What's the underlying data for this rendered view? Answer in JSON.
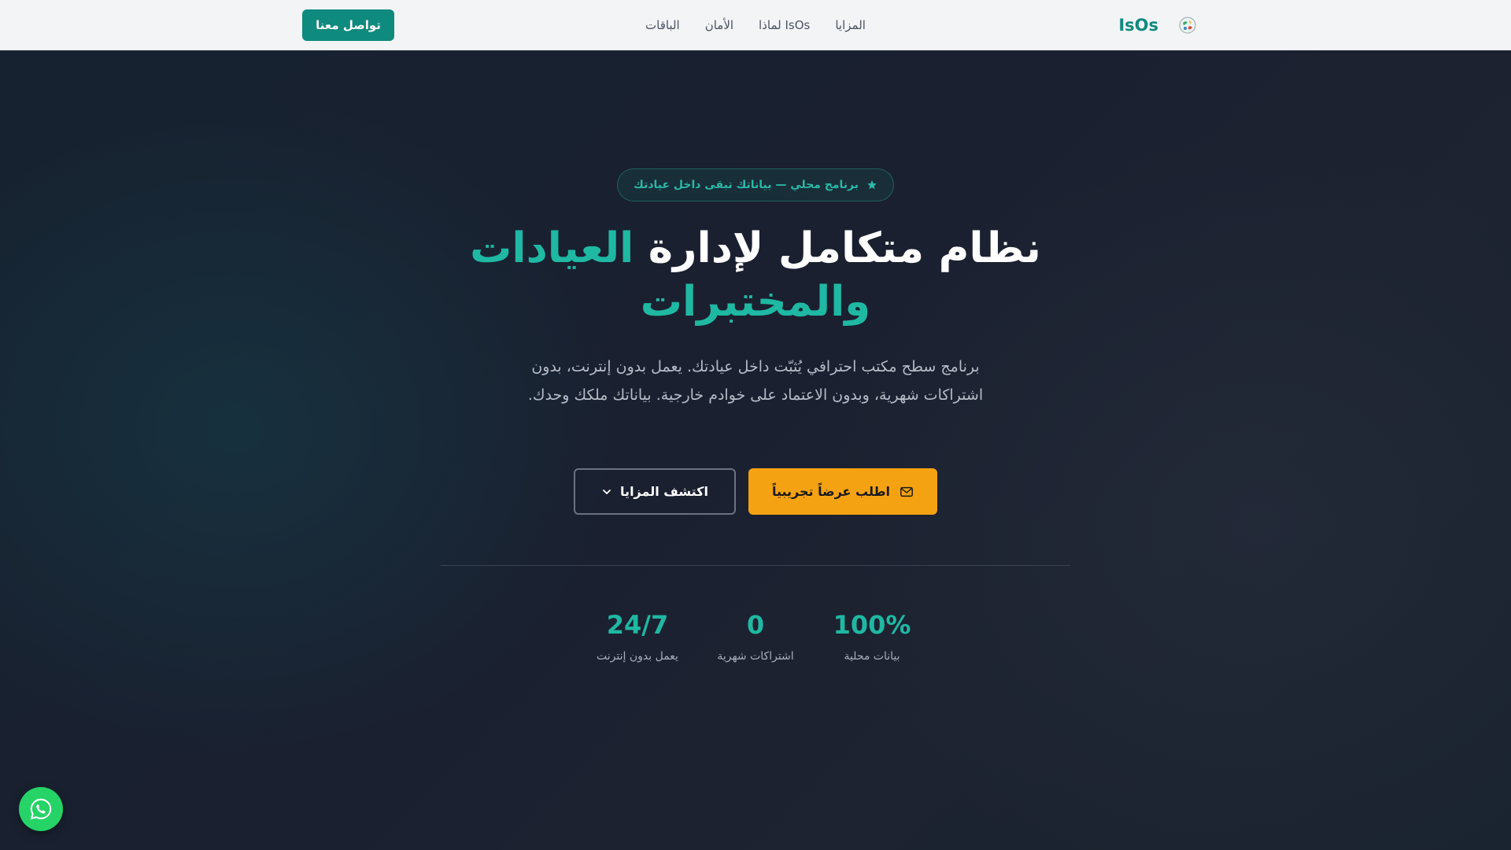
{
  "header": {
    "brand_name": "IsOs",
    "logo_icon": "globe-logo-icon",
    "nav": [
      {
        "label": "المزايا"
      },
      {
        "label": "لماذا IsOs"
      },
      {
        "label": "الأمان"
      },
      {
        "label": "الباقات"
      }
    ],
    "contact_label": "تواصل معنا"
  },
  "hero": {
    "badge_icon": "star-icon",
    "badge_text": "برنامج محلي — بياناتك تبقى داخل عيادتك",
    "title_main": "نظام متكامل لإدارة",
    "title_accent": "العيادات والمختبرات",
    "subtitle": "برنامج سطح مكتب احترافي يُثبّت داخل عيادتك. يعمل بدون إنترنت، بدون اشتراكات شهرية، وبدون الاعتماد على خوادم خارجية. بياناتك ملكك وحدك.",
    "primary_cta": "اطلب عرضاً تجريبياً",
    "primary_cta_icon": "mail-icon",
    "secondary_cta": "اكتشف المزايا",
    "secondary_cta_icon": "chevron-down-icon"
  },
  "stats": [
    {
      "value": "100%",
      "label": "بيانات محلية"
    },
    {
      "value": "0",
      "label": "اشتراكات شهرية"
    },
    {
      "value": "24/7",
      "label": "يعمل بدون إنترنت"
    }
  ],
  "floating": {
    "whatsapp_icon": "whatsapp-icon"
  },
  "colors": {
    "accent": "#1fb8a3",
    "brand": "#0f8a7e",
    "cta": "#f5a212",
    "nav_bg": "#f3f4f6",
    "hero_bg": "#1a2230",
    "whatsapp": "#25d366"
  }
}
